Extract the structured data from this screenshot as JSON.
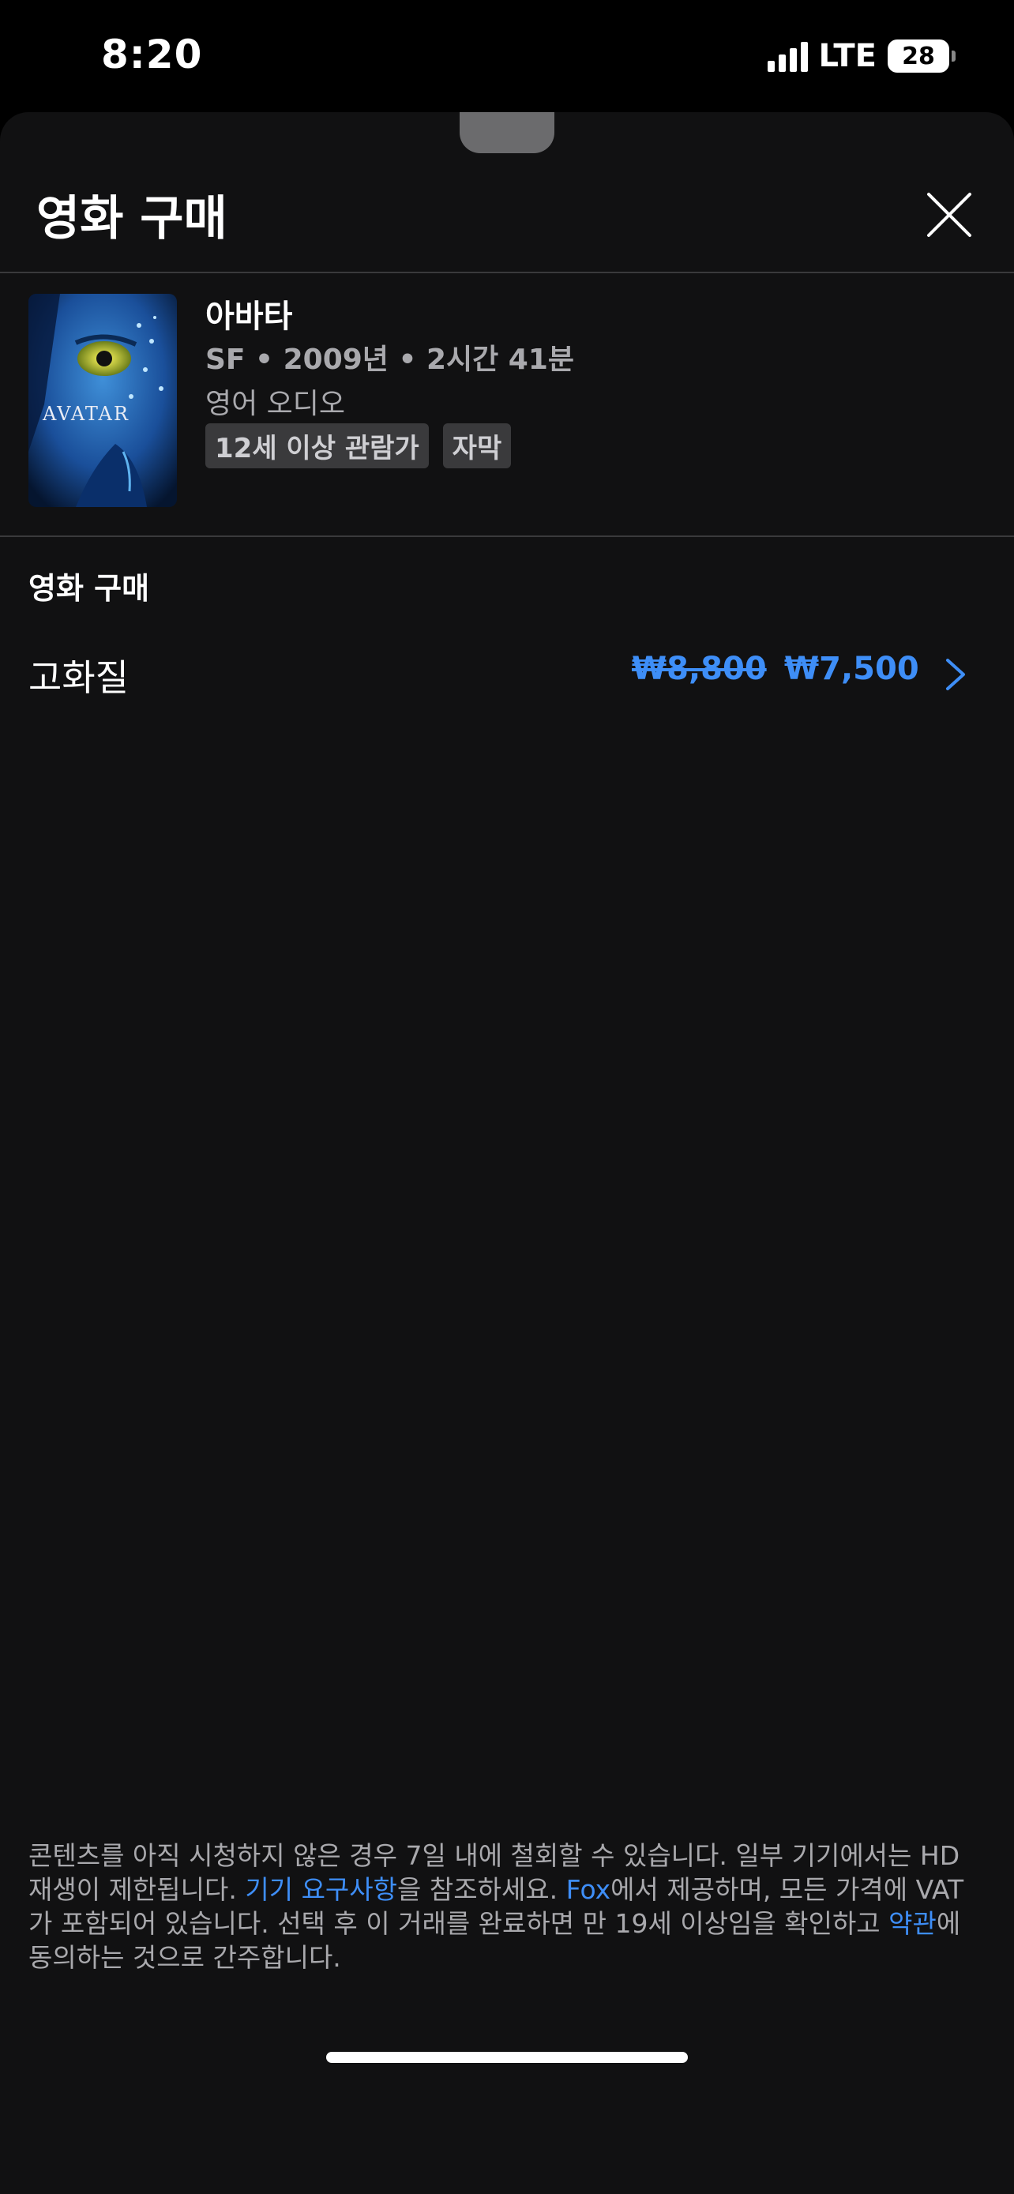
{
  "status_bar": {
    "time": "8:20",
    "network": "LTE",
    "battery": "28"
  },
  "sheet": {
    "title": "영화 구매"
  },
  "movie": {
    "title": "아바타",
    "meta": "SF • 2009년 • 2시간 41분",
    "audio": "영어 오디오",
    "badges": [
      "12세 이상 관람가",
      "자막"
    ],
    "poster_text": "AVATAR"
  },
  "purchase": {
    "section_label": "영화 구매",
    "options": [
      {
        "quality": "고화질",
        "original_price": "₩8,800",
        "sale_price": "₩7,500"
      }
    ]
  },
  "footer": {
    "part1": "콘텐츠를 아직 시청하지 않은 경우 7일 내에 철회할 수 있습니다. 일부 기기에서는 HD 재생이 제한됩니다. ",
    "link_device": "기기 요구사항",
    "part2": "을 참조하세요. ",
    "link_provider": "Fox",
    "part3": "에서 제공하며, 모든 가격에 VAT가 포함되어 있습니다. 선택 후 이 거래를 완료하면 만 19세 이상임을 확인하고 ",
    "link_terms": "약관",
    "part4": "에 동의하는 것으로 간주합니다."
  },
  "colors": {
    "accent": "#3e8ef7",
    "sheet_background": "#111112",
    "secondary_text": "#a9a9ad"
  },
  "icons": {
    "close": "close-icon",
    "chevron": "chevron-right-icon"
  }
}
